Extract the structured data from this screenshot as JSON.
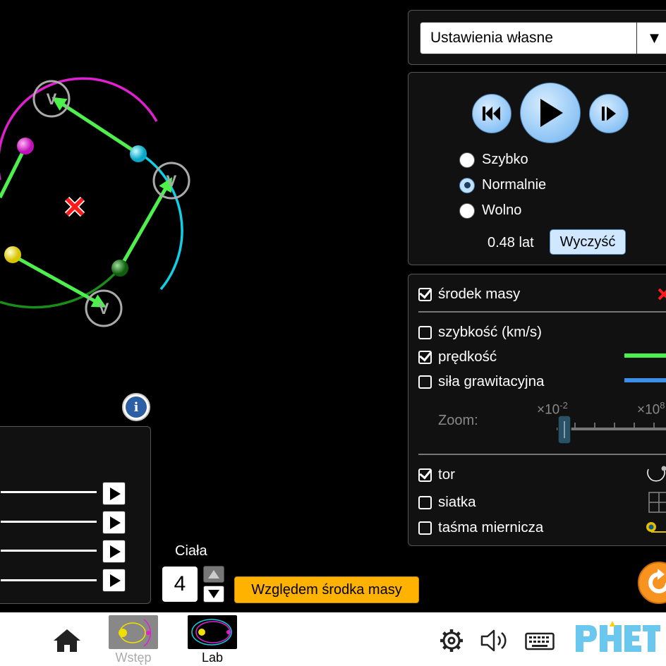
{
  "preset": {
    "selected": "Ustawienia własne"
  },
  "playback": {
    "speeds": [
      {
        "label": "Szybko",
        "selected": false
      },
      {
        "label": "Normalnie",
        "selected": true
      },
      {
        "label": "Wolno",
        "selected": false
      }
    ],
    "time_value": "0.48",
    "time_unit": "lat",
    "clear_label": "Wyczyść"
  },
  "options": {
    "center_of_mass": {
      "label": "środek masy",
      "checked": true
    },
    "speed": {
      "label": "szybkość (km/s)",
      "checked": false
    },
    "velocity": {
      "label": "prędkość",
      "checked": true
    },
    "gravity_force": {
      "label": "siła grawitacyjna",
      "checked": false
    },
    "zoom_label": "Zoom:",
    "zoom_min_base": "×10",
    "zoom_min_exp": "-2",
    "zoom_max_base": "×10",
    "zoom_max_exp": "8",
    "path": {
      "label": "tor",
      "checked": true
    },
    "grid": {
      "label": "siatka",
      "checked": false
    },
    "measuring_tape": {
      "label": "taśma miernicza",
      "checked": false
    }
  },
  "bodies": {
    "label": "Ciała",
    "value": "4"
  },
  "com_button_label": "Względem środka masy",
  "velocity_marker": "V",
  "nav": {
    "screens": [
      {
        "label": "Wstęp",
        "selected": false
      },
      {
        "label": "Lab",
        "selected": true
      }
    ]
  },
  "colors": {
    "magenta_body": "#e020d0",
    "cyan_body": "#10d0e8",
    "green_body": "#1a8c1a",
    "yellow_body": "#f0e000",
    "velocity_arrow": "#4ef04e",
    "force_arrow": "#3a8fe8",
    "com_marker": "#ff1a1a",
    "button_orange": "#ffb300",
    "button_blue": "#cfe7ff",
    "phet_blue": "#6ac8ef"
  }
}
